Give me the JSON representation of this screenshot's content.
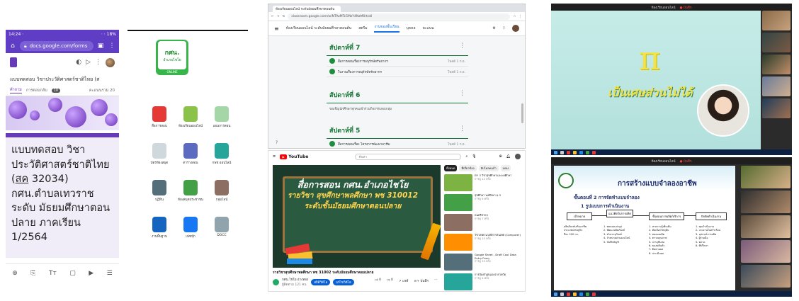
{
  "panel1": {
    "status_time": "14:24 ⋅",
    "status_right": "⋅ ⋅ 18%",
    "url": "docs.google.com/forms",
    "form_header": "แบบทดสอบ วิชาประวัติศาสตร์ชาติไทย (ส",
    "tab_questions": "คำถาม",
    "tab_responses": "การตอบกลับ",
    "responses_count": "10",
    "score_label": "คะแนนรวม 20",
    "card_line1": "แบบทดสอบ วิชา",
    "card_line2": "ประวัติศาสตร์ชาติไทย",
    "card_line3_pre": "(",
    "card_line3_u": "สค",
    "card_line3_post": " 32034)",
    "card_line4": "กศน.ตำบลเทวราช",
    "card_line5": "ระดับ มัธยมศึกษาตอน",
    "card_line6": "ปลาย      ภาคเรียน",
    "card_line7": "1/2564",
    "colors": {
      "accent": "#673ab7",
      "statusbar": "#5f3dc4"
    }
  },
  "panel2": {
    "logo_l1": "กศน.",
    "logo_l2": "อำเภอไชโย",
    "logo_l3": "ONLINE",
    "apps": [
      {
        "label": "สื่อการสอน",
        "icon": "video-play-icon",
        "color": "#e53935"
      },
      {
        "label": "ห้องเรียนออนไลน์",
        "icon": "classroom-icon",
        "color": "#8bc34a"
      },
      {
        "label": "แผนการสอน",
        "icon": "document-icon",
        "color": "#a5d6a7"
      },
      {
        "label": "บัตรห้องสมุด",
        "icon": "card-icon",
        "color": "#cfd8dc"
      },
      {
        "label": "ตารางสอน",
        "icon": "calendar-icon",
        "color": "#5c6bc0"
      },
      {
        "label": "กพช ออนไลน์",
        "icon": "badge-icon",
        "color": "#26a69a"
      },
      {
        "label": "ปฏิทิน",
        "icon": "phone-icon",
        "color": "#546e7a"
      },
      {
        "label": "ห้องสมุดประชาชน",
        "icon": "seal-icon",
        "color": "#43a047"
      },
      {
        "label": "กลุ่มไลน์",
        "icon": "group-icon",
        "color": "#8d6e63"
      },
      {
        "label": "งานพื้นฐาน",
        "icon": "globe-icon",
        "color": "#1565c0"
      },
      {
        "label": "เฟซบุ๊ก",
        "icon": "facebook-icon",
        "color": "#1877f2"
      },
      {
        "label": "DOCC",
        "icon": "docc-icon",
        "color": "#90a4ae"
      }
    ]
  },
  "panel3": {
    "tab_title": "ห้องเรียนออนไลน์ ระดับมัธยมศึกษาตอนต้น",
    "address": "classroom.google.com/w/NTAzMTc5MzY4NzM0/t/all",
    "course_name": "ห้องเรียนออนไลน์ ระดับมัธยมศึกษาตอนต้น",
    "nav": [
      "สตรีม",
      "งานของชั้นเรียน",
      "บุคคล",
      "คะแนน"
    ],
    "weeks": [
      {
        "title": "สัปดาห์ที่ 7",
        "items": [
          {
            "text": "สื่อการสอนเรื่องการอนุรักษ์ทรัพยากร",
            "date": "โพสต์ 1 ก.ย."
          },
          {
            "text": "ใบงานเรื่องการอนุรักษ์ทรัพยากร",
            "date": "โพสต์ 1 ก.ย."
          }
        ]
      },
      {
        "title": "สัปดาห์ที่ 6",
        "note": "ขอเชิญนักศึกษาทุกคนเข้าร่วมกิจกรรมพบกลุ่ม"
      },
      {
        "title": "สัปดาห์ที่ 5",
        "items": [
          {
            "text": "สื่อการสอนเรื่อง โครงการพัฒนาอาชีพ",
            "date": "โพสต์ 1 ก.ย."
          }
        ]
      }
    ]
  },
  "panel4": {
    "logo_text": "YouTube",
    "search_placeholder": "ค้นหา",
    "board_line1": "สื่อการสอน กศน.อำเภอไชโย",
    "board_line2": "รายวิชา สุขศึกษาพลศึกษา พช 310012",
    "board_line3": "ระดับชั้นมัธยมศึกษาตอนปลาย",
    "video_title": "รายวิชาสุขศึกษาพลศึกษา พช 31002 ระดับมัธยมศึกษาตอนปลาย",
    "channel_name": "กศน.ไชโย อ่างทอง",
    "subscribers": "ผู้ติดตาม 121 คน",
    "analytics_btn": "สถิติวิดีโอ",
    "edit_btn": "แก้ไขวิดีโอ",
    "likes": "0",
    "dislikes": "0",
    "share": "แชร์",
    "save": "บันทึก",
    "chips": [
      "ทั้งหมด",
      "ที่เกี่ยวข้อง",
      "อัปโหลดแล้ว",
      "เพลง"
    ],
    "suggestions": [
      {
        "title": "EP. 3 วิชาสุขศึกษาและพลศึกษา",
        "meta": "การดู 12 ครั้ง"
      },
      {
        "title": "สุขศึกษา พลศึกษา ม.3",
        "meta": "การดู 9 ครั้ง"
      },
      {
        "title": "ดนตรีสากล",
        "meta": "การดู 7 ครั้ง"
      },
      {
        "title": "วิชาเทคโนโลยีสารสนเทศ (Computer)",
        "meta": "การดู 15 ครั้ง"
      },
      {
        "title": "Google Sheet - Draft Cool Data Entry Form",
        "meta": "การดู 33 ครั้ง"
      },
      {
        "title": "การป้องกันตนเองจากโควิด",
        "meta": "การดู 4 ครั้ง"
      }
    ]
  },
  "panel5": {
    "meeting_title": "ห้องเรียนออนไลน์",
    "rec_label": "● บันทึก",
    "pi_symbol": "π",
    "pi_caption": "เป็นเศษส่วนไม่ได้"
  },
  "panel6": {
    "meeting_title": "ห้องเรียนออนไลน์",
    "rec_label": "● บันทึก",
    "slide_title": "การสร้างแบบจำลองอาชีพ",
    "slide_step": "ขั้นตอนที่ 2 การจัดทำแบบจำลอง",
    "slide_sub": "1 รูปแบบการดำเนินงาน",
    "boxes": [
      "เป้าหมาย",
      "แนวคิดในการผลิต",
      "ขั้นตอนการผลิต/บริการ",
      "ปัจจัยดำเนินงาน"
    ],
    "col1": [
      "ผลิตภัณฑ์เสริมอาชีพ",
      "ประเภทเศรษฐกิจ",
      "ปีละ 200 กก."
    ],
    "col2": [
      "1. ทดลองแปรรูป",
      "2. พัฒนาผลิตภัณฑ์",
      "3. ทำบรรจุภัณฑ์",
      "4. จำหน่ายผ่านออนไลน์",
      "5. บันทึกบัญชี"
    ],
    "col3": [
      "1. หาความรู้เพิ่มเติม",
      "2. คัดเลือกวัตถุดิบ",
      "3. ทดลองผลิต",
      "4. ตรวจคุณภาพ",
      "5. บรรจุหีบห่อ",
      "6. ขนส่งสินค้า",
      "7. ติดตามผล",
      "8. ประเมินผล"
    ],
    "col4": [
      "1. ทุนดำเนินงาน",
      "2. แรงงานในครัวเรือน",
      "3. อุปกรณ์การผลิต",
      "4. ผู้ร่วมมือ",
      "5. ตลาด",
      "6. ที่ปรึกษา"
    ]
  }
}
